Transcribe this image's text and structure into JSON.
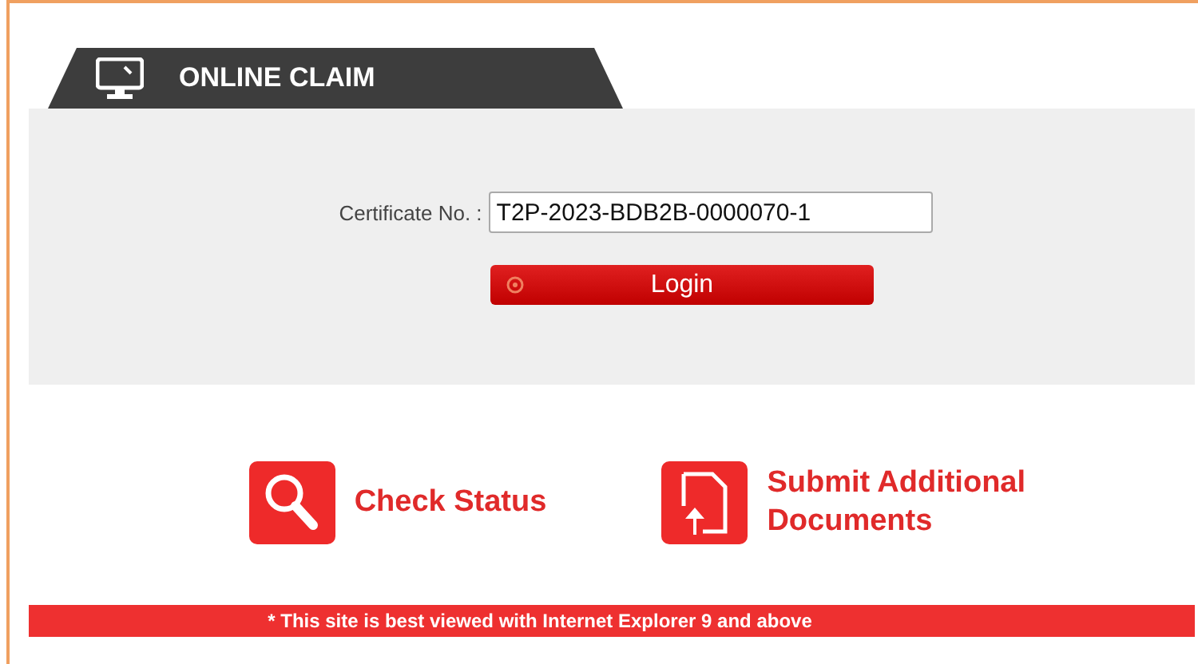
{
  "tab": {
    "title": "ONLINE CLAIM"
  },
  "form": {
    "label": "Certificate No. :",
    "value": "T2P-2023-BDB2B-0000070-1",
    "button": "Login"
  },
  "links": [
    {
      "kind": "search",
      "label": "Check Status"
    },
    {
      "kind": "upload",
      "label": "Submit Additional Documents"
    }
  ],
  "footer": "* This site is best viewed with Internet Explorer 9 and above"
}
